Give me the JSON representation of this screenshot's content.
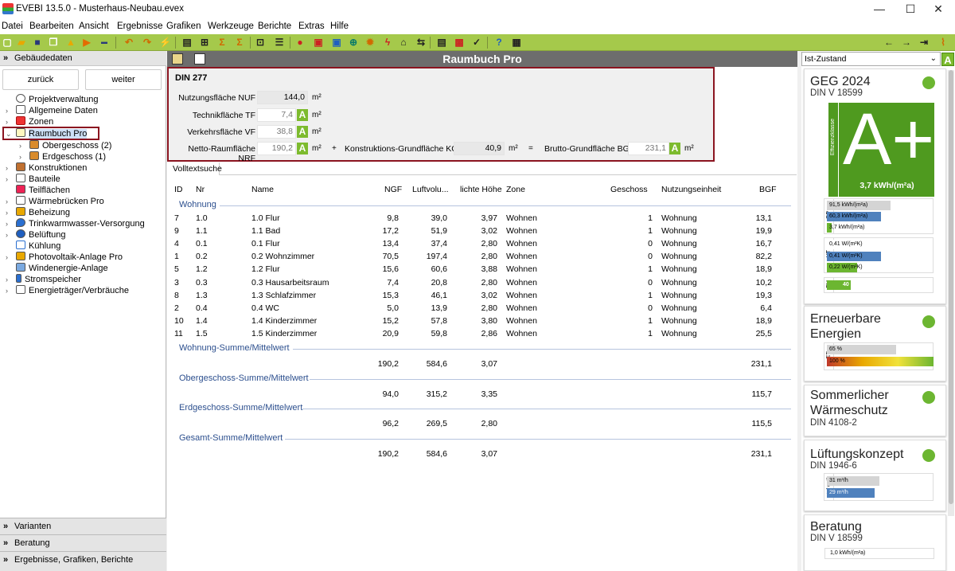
{
  "window": {
    "title": "EVEBI 13.5.0 - Musterhaus-Neubau.evex",
    "min": "—",
    "max": "☐",
    "close": "✕"
  },
  "menu": [
    "Datei",
    "Bearbeiten",
    "Ansicht",
    "Ergebnisse",
    "Grafiken",
    "Werkzeuge",
    "Berichte",
    "Extras",
    "Hilfe"
  ],
  "left": {
    "header": "Gebäudedaten",
    "back": "zurück",
    "next": "weiter",
    "tree": [
      "Projektverwaltung",
      "Allgemeine Daten",
      "Zonen",
      "Raumbuch Pro",
      "Obergeschoss (2)",
      "Erdgeschoss (1)",
      "Konstruktionen",
      "Bauteile",
      "Teilflächen",
      "Wärmebrücken Pro",
      "Beheizung",
      "Trinkwarmwasser-Versorgung",
      "Belüftung",
      "Kühlung",
      "Photovoltaik-Anlage Pro",
      "Windenergie-Anlage",
      "Stromspeicher",
      "Energieträger/Verbräuche"
    ],
    "bottom": [
      "Varianten",
      "Beratung",
      "Ergebnisse, Grafiken, Berichte"
    ]
  },
  "center": {
    "title": "Raumbuch Pro",
    "din": {
      "title": "DIN 277",
      "nuf_label": "Nutzungsfläche NUF",
      "nuf": "144,0",
      "tf_label": "Technikfläche TF",
      "tf": "7,4",
      "vf_label": "Verkehrsfläche VF",
      "vf": "38,8",
      "nrf_label": "Netto-Raumfläche NRF",
      "nrf": "190,2",
      "plus": "+",
      "kgf_label": "Konstruktions-Grundfläche KGF",
      "kgf": "40,9",
      "eq": "=",
      "bgf_label": "Brutto-Grundfläche BGF",
      "bgf": "231,1",
      "unit": "m²",
      "badge": "A"
    },
    "search_tab": "Volltextsuche",
    "columns": [
      "ID",
      "Nr",
      "Name",
      "NGF",
      "Luftvolu...",
      "lichte Höhe",
      "Zone",
      "Geschoss",
      "Nutzungseinheit",
      "BGF"
    ],
    "group_wohnung": "Wohnung",
    "rows": [
      [
        "7",
        "1.0",
        "1.0 Flur",
        "9,8",
        "39,0",
        "3,97",
        "Wohnen",
        "1",
        "Wohnung",
        "13,1"
      ],
      [
        "9",
        "1.1",
        "1.1 Bad",
        "17,2",
        "51,9",
        "3,02",
        "Wohnen",
        "1",
        "Wohnung",
        "19,9"
      ],
      [
        "4",
        "0.1",
        "0.1 Flur",
        "13,4",
        "37,4",
        "2,80",
        "Wohnen",
        "0",
        "Wohnung",
        "16,7"
      ],
      [
        "1",
        "0.2",
        "0.2 Wohnzimmer",
        "70,5",
        "197,4",
        "2,80",
        "Wohnen",
        "0",
        "Wohnung",
        "82,2"
      ],
      [
        "5",
        "1.2",
        "1.2 Flur",
        "15,6",
        "60,6",
        "3,88",
        "Wohnen",
        "1",
        "Wohnung",
        "18,9"
      ],
      [
        "3",
        "0.3",
        "0.3 Hausarbeitsraum",
        "7,4",
        "20,8",
        "2,80",
        "Wohnen",
        "0",
        "Wohnung",
        "10,2"
      ],
      [
        "8",
        "1.3",
        "1.3 Schlafzimmer",
        "15,3",
        "46,1",
        "3,02",
        "Wohnen",
        "1",
        "Wohnung",
        "19,3"
      ],
      [
        "2",
        "0.4",
        "0.4 WC",
        "5,0",
        "13,9",
        "2,80",
        "Wohnen",
        "0",
        "Wohnung",
        "6,4"
      ],
      [
        "10",
        "1.4",
        "1.4 Kinderzimmer",
        "15,2",
        "57,8",
        "3,80",
        "Wohnen",
        "1",
        "Wohnung",
        "18,9"
      ],
      [
        "11",
        "1.5",
        "1.5 Kinderzimmer",
        "20,9",
        "59,8",
        "2,86",
        "Wohnen",
        "1",
        "Wohnung",
        "25,5"
      ]
    ],
    "sums": [
      {
        "label": "Wohnung-Summe/Mittelwert",
        "ngf": "190,2",
        "luft": "584,6",
        "hoehe": "3,07",
        "bgf": "231,1"
      },
      {
        "label": "Obergeschoss-Summe/Mittelwert",
        "ngf": "94,0",
        "luft": "315,2",
        "hoehe": "3,35",
        "bgf": "115,7"
      },
      {
        "label": "Erdgeschoss-Summe/Mittelwert",
        "ngf": "96,2",
        "luft": "269,5",
        "hoehe": "2,80",
        "bgf": "115,5"
      },
      {
        "label": "Gesamt-Summe/Mittelwert",
        "ngf": "190,2",
        "luft": "584,6",
        "hoehe": "3,07",
        "bgf": "231,1"
      }
    ]
  },
  "right": {
    "state": "Ist-Zustand",
    "geg": {
      "title": "GEG 2024",
      "sub": "DIN V 18599",
      "effclass_label": "Effizienzklasse",
      "grade": "A+",
      "value": "3,7 kWh/(m²a)",
      "qp_label": "QP",
      "qp": [
        "91,5 kWh/(m²a)",
        "60,3 kWh/(m²a)",
        "3,7 kWh/(m²a)"
      ],
      "ht_label": "HT",
      "ht": [
        "0,41 W/(m²K)",
        "0,41 W/(m²K)",
        "0,22 W/(m²K)"
      ],
      "eh_label": "EH",
      "eh": "40"
    },
    "ee": {
      "title1": "Erneuerbare",
      "title2": "Energien",
      "label": "EE",
      "bars": [
        "65 %",
        "100 %"
      ]
    },
    "sws": {
      "title1": "Sommerlicher",
      "title2": "Wärmeschutz",
      "sub": "DIN 4108-2"
    },
    "lk": {
      "title": "Lüftungskonzept",
      "sub": "DIN 1946-6",
      "label": "inf qvtl",
      "bars": [
        "31 m³/h",
        "29 m³/h"
      ]
    },
    "ber": {
      "title": "Beratung",
      "sub": "DIN V 18599",
      "bar": "1,0 kWh/(m²a)"
    },
    "colors": {
      "green": "#6cb631",
      "class": "#4f9a1f",
      "blue": "#4f81bd",
      "red": "#c0392b"
    }
  }
}
